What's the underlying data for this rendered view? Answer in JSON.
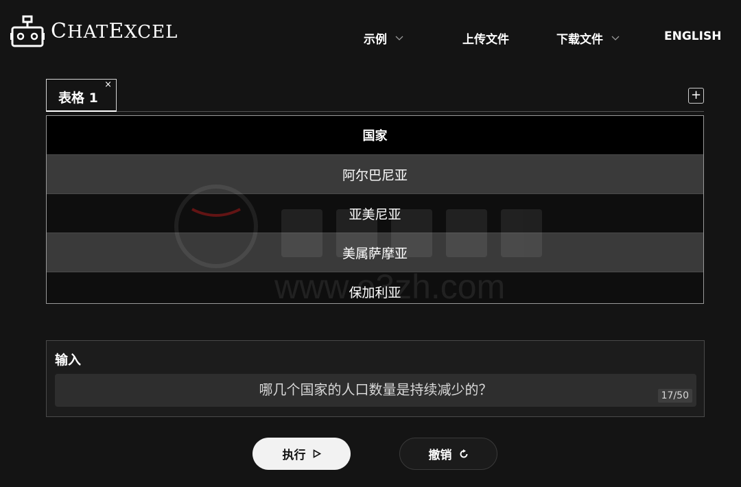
{
  "app": {
    "logo_text_first": "C",
    "logo_text_rest": "HAT",
    "logo_text_second_big": "E",
    "logo_text_second_rest": "XCEL"
  },
  "nav": {
    "examples": "示例",
    "upload": "上传文件",
    "download": "下载文件",
    "language": "ENGLISH"
  },
  "tabs": {
    "active_label": "表格 1",
    "close_glyph": "×",
    "add_glyph": "+"
  },
  "table": {
    "header": "国家",
    "rows": [
      "阿尔巴尼亚",
      "亚美尼亚",
      "美属萨摩亚",
      "保加利亚"
    ]
  },
  "watermark": {
    "url": "www.e3zh.com"
  },
  "input": {
    "label": "输入",
    "value": "哪几个国家的人口数量是持续减少的？",
    "counter": "17/50"
  },
  "buttons": {
    "run": "执行",
    "run_icon": "play-icon",
    "undo": "撤销",
    "undo_icon": "undo-icon"
  },
  "colors": {
    "background": "#141414",
    "row_alt": "#3a3a3a",
    "row_plain": "#0e0e0e",
    "header_bg": "#000000",
    "run_button": "#f2f2f2"
  }
}
